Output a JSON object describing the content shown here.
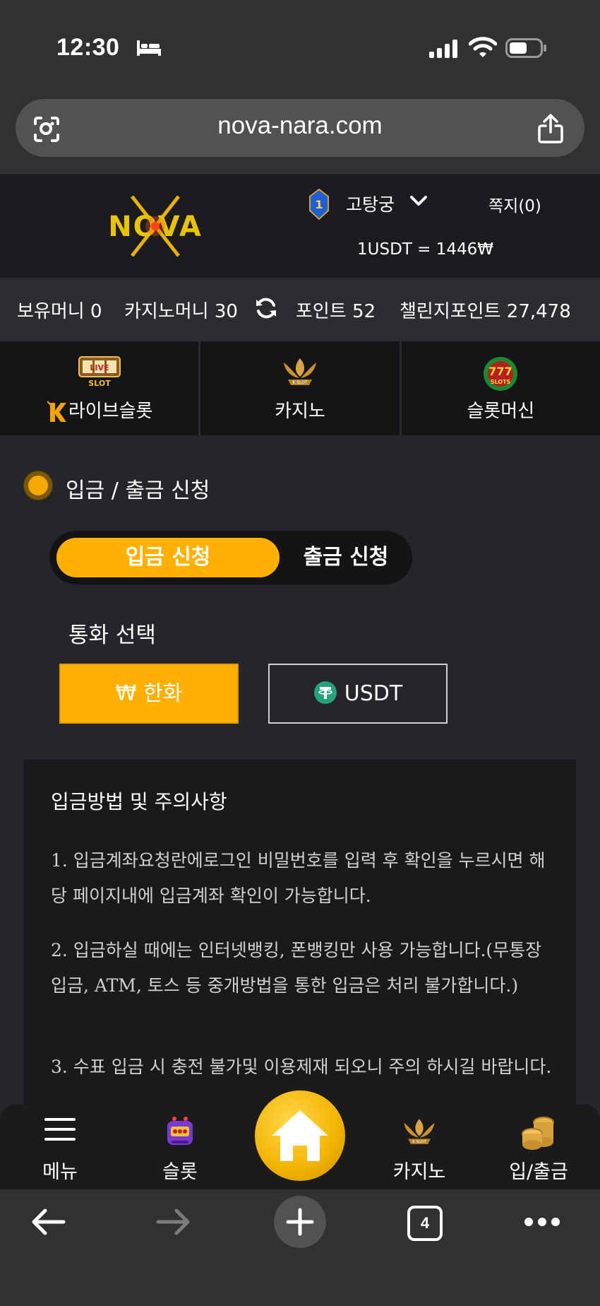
{
  "status_bar": {
    "time": "12:30"
  },
  "browser": {
    "url": "nova-nara.com",
    "tab_count": "4"
  },
  "header": {
    "logo_text": "NOVA",
    "level": "1",
    "username": "고탕궁",
    "messages": "쪽지(0)",
    "exchange_rate": "1USDT = 1446₩"
  },
  "balances": {
    "money": "보유머니 0",
    "casino_money": "카지노머니 30",
    "points": "포인트 52",
    "challenge_points": "챌린지포인트 27,478"
  },
  "game_tabs": [
    {
      "label": "라이브슬롯",
      "icon": "live-slot-icon"
    },
    {
      "label": "카지노",
      "icon": "k-slot-icon"
    },
    {
      "label": "슬롯머신",
      "icon": "777-slots-icon"
    }
  ],
  "section": {
    "title": "입금 / 출금 신청",
    "deposit_tab": "입금 신청",
    "withdraw_tab": "출금 신청",
    "currency_label": "통화 선택",
    "currency_krw": "₩ 한화",
    "currency_usdt": "USDT"
  },
  "notice": {
    "title": "입금방법 및 주의사항",
    "items": [
      "1. 입금계좌요청란에로그인 비밀번호를 입력 후 확인을 누르시면 해당 페이지내에 입금계좌 확인이 가능합니다.",
      "2. 입금하실 때에는 인터넷뱅킹, 폰뱅킹만 사용 가능합니다.(무통장입금, ATM, 토스 등 중개방법을 통한 입금은 처리 불가합니다.)",
      "3. 수표 입금 시 충전 불가및 이용제재 되오니 주의 하시길 바랍니다."
    ]
  },
  "bottom_nav": {
    "menu": "메뉴",
    "slot": "슬롯",
    "casino": "카지노",
    "deposit_withdraw": "입/출금"
  },
  "colors": {
    "accent": "#ffb000",
    "background": "#25252a"
  }
}
